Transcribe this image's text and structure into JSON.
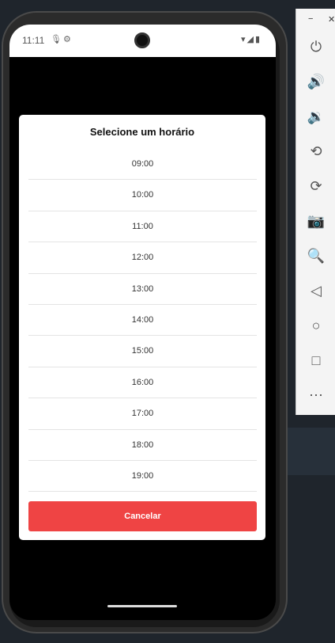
{
  "status_bar": {
    "time": "11:11",
    "icons_left": [
      "mic-icon",
      "gear-icon"
    ],
    "icons_right": [
      "wifi-icon",
      "signal-icon",
      "battery-icon"
    ]
  },
  "modal": {
    "title": "Selecione um horário",
    "slots": [
      "09:00",
      "10:00",
      "11:00",
      "12:00",
      "13:00",
      "14:00",
      "15:00",
      "16:00",
      "17:00",
      "18:00",
      "19:00"
    ],
    "cancel_label": "Cancelar"
  },
  "emulator_toolbar": {
    "buttons": [
      "power-icon",
      "volume-up-icon",
      "volume-down-icon",
      "rotate-left-icon",
      "rotate-right-icon",
      "camera-icon",
      "zoom-icon",
      "back-icon",
      "home-icon",
      "overview-icon",
      "more-icon"
    ]
  },
  "colors": {
    "accent_red": "#ef4444",
    "modal_bg": "#ffffff",
    "backdrop": "#000000"
  }
}
